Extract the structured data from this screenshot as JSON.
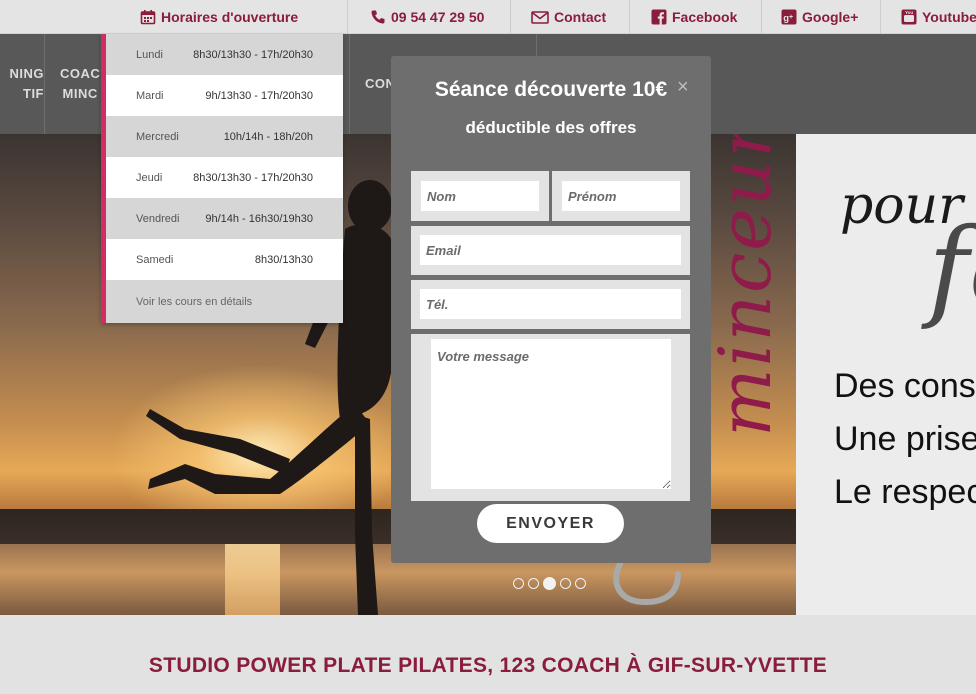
{
  "topbar": {
    "hours": "Horaires d'ouverture",
    "phone": "09 54 47 29 50",
    "contact": "Contact",
    "facebook": "Facebook",
    "googleplus": "Google+",
    "youtube": "Youtube"
  },
  "nav": {
    "item1_line1": "NING",
    "item1_line2": "TIF",
    "item2_line1": "COAC",
    "item2_line2": "MINC",
    "item3": "CON"
  },
  "hours": [
    {
      "day": "Lundi",
      "time": "8h30/13h30 - 17h/20h30"
    },
    {
      "day": "Mardi",
      "time": "9h/13h30 - 17h/20h30"
    },
    {
      "day": "Mercredi",
      "time": "10h/14h - 18h/20h"
    },
    {
      "day": "Jeudi",
      "time": "8h30/13h30 - 17h/20h30"
    },
    {
      "day": "Vendredi",
      "time": "9h/14h - 16h30/19h30"
    },
    {
      "day": "Samedi",
      "time": "8h30/13h30"
    }
  ],
  "hours_more": "Voir les cours en détails",
  "modal": {
    "title": "Séance découverte 10€",
    "subtitle": "déductible des offres",
    "close": "×",
    "nom_placeholder": "Nom",
    "prenom_placeholder": "Prénom",
    "email_placeholder": "Email",
    "tel_placeholder": "Tél.",
    "message_placeholder": "Votre message",
    "send": "ENVOYER"
  },
  "hero": {
    "vertical_word": "minceur",
    "pour": "pour r",
    "f": "fo",
    "line1": "Des conse",
    "line2": "Une prise",
    "line3": "Le respec",
    "slides": 5,
    "active_slide": 3
  },
  "band": {
    "title": "STUDIO POWER PLATE PILATES, 123 COACH À GIF-SUR-YVETTE"
  },
  "colors": {
    "accent": "#8a1c3c",
    "pink": "#d32b63",
    "nav_bg": "#585858",
    "modal_bg": "#6e6e6e"
  },
  "icons": [
    "calendar-icon",
    "phone-icon",
    "envelope-icon",
    "facebook-icon",
    "google-plus-icon",
    "youtube-icon"
  ]
}
